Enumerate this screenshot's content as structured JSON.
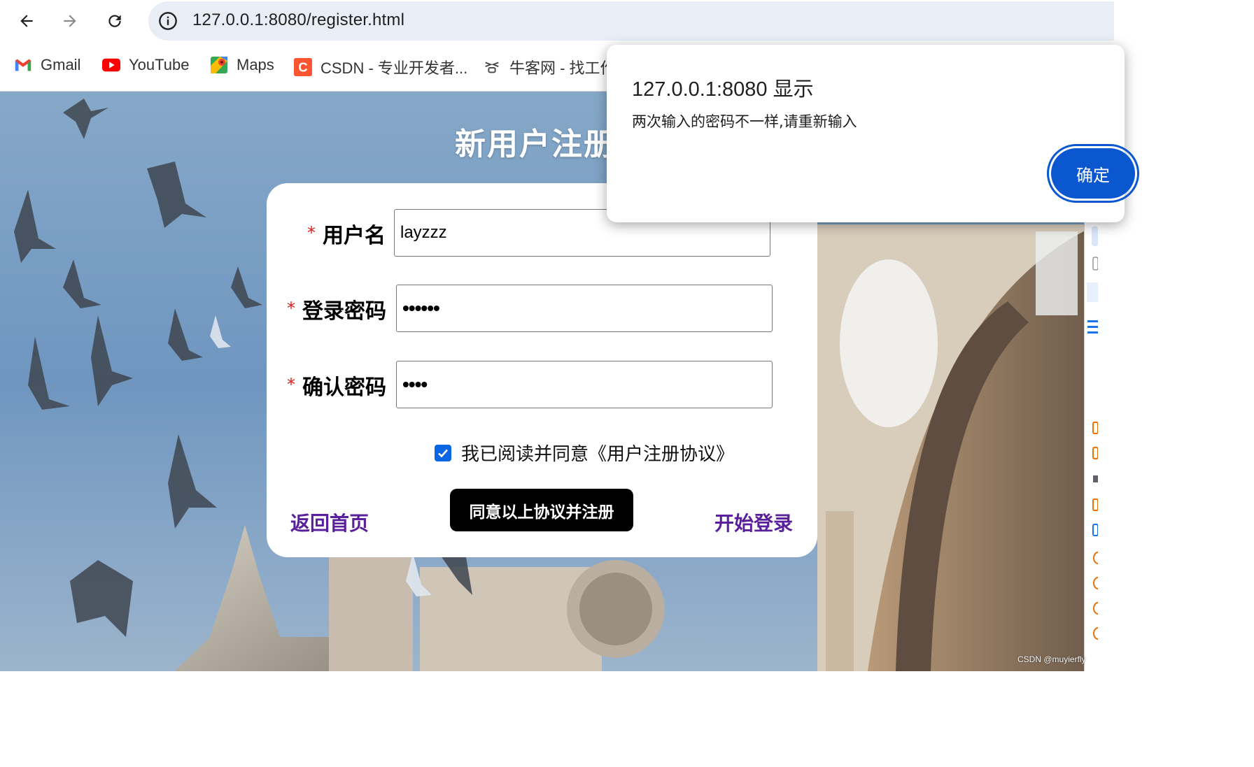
{
  "browser": {
    "url": "127.0.0.1:8080/register.html",
    "bookmarks": [
      {
        "label": "Gmail",
        "icon": "gmail-icon"
      },
      {
        "label": "YouTube",
        "icon": "youtube-icon"
      },
      {
        "label": "Maps",
        "icon": "maps-icon"
      },
      {
        "label": "CSDN - 专业开发者...",
        "icon": "csdn-icon"
      },
      {
        "label": "牛客网 - 找工作",
        "icon": "nowcoder-icon"
      }
    ]
  },
  "page": {
    "title": "新用户注册",
    "form": {
      "username_label": "用户名",
      "username_value": "layzzz",
      "password_label": "登录密码",
      "password_mask": "••••••",
      "confirm_label": "确认密码",
      "confirm_mask": "••••",
      "required_mark": "*",
      "agree_text": "我已阅读并同意《用户注册协议》",
      "agree_checked": true,
      "submit_label": "同意以上协议并注册",
      "back_link": "返回首页",
      "login_link": "开始登录"
    }
  },
  "dialog": {
    "title": "127.0.0.1:8080 显示",
    "message": "两次输入的密码不一样,请重新输入",
    "ok_label": "确定"
  },
  "watermark": "CSDN @muyierfly",
  "colors": {
    "accent": "#0b57d0",
    "link": "#5a1f9a",
    "required": "#e01a1a"
  }
}
